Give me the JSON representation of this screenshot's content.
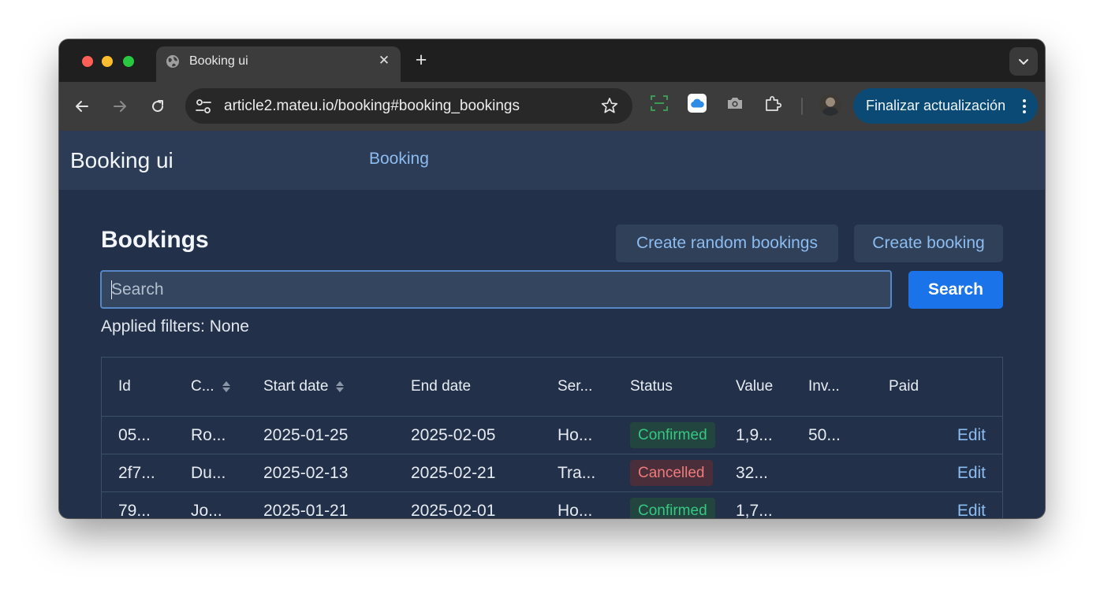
{
  "browser": {
    "tab_title": "Booking ui",
    "url": "article2.mateu.io/booking#booking_bookings",
    "update_button": "Finalizar actualización",
    "icons": [
      "globe-icon",
      "close-icon",
      "plus-icon",
      "chevron-down-icon",
      "back-icon",
      "forward-icon",
      "reload-icon",
      "site-settings-icon",
      "star-icon",
      "screenshot-icon",
      "icloud-icon",
      "camera-icon",
      "extensions-icon",
      "more-vert-icon"
    ]
  },
  "app": {
    "brand": "Booking ui",
    "nav": [
      "Booking"
    ]
  },
  "page": {
    "title": "Bookings",
    "create_random_label": "Create random bookings",
    "create_label": "Create booking",
    "search_placeholder": "Search",
    "search_button": "Search",
    "filters_text": "Applied filters: None"
  },
  "table": {
    "columns": [
      "Id",
      "C...",
      "Start date",
      "End date",
      "Ser...",
      "Status",
      "Value",
      "Inv...",
      "Paid"
    ],
    "rows": [
      {
        "id": "05...",
        "customer": "Ro...",
        "start": "2025-01-25",
        "end": "2025-02-05",
        "service": "Ho...",
        "status": "Confirmed",
        "value": "1,9...",
        "invoiced": "50...",
        "paid": "",
        "action": "Edit"
      },
      {
        "id": "2f7...",
        "customer": "Du...",
        "start": "2025-02-13",
        "end": "2025-02-21",
        "service": "Tra...",
        "status": "Cancelled",
        "value": "32...",
        "invoiced": "",
        "paid": "",
        "action": "Edit"
      },
      {
        "id": "79...",
        "customer": "Jo...",
        "start": "2025-01-21",
        "end": "2025-02-01",
        "service": "Ho...",
        "status": "Confirmed",
        "value": "1,7...",
        "invoiced": "",
        "paid": "",
        "action": "Edit"
      }
    ]
  },
  "colors": {
    "page_bg": "#223049",
    "header_bg": "#2c3c57",
    "accent_link": "#8cbcf0",
    "primary_button": "#1a73e8",
    "confirmed": "#36c783",
    "cancelled": "#ee7b7b"
  }
}
